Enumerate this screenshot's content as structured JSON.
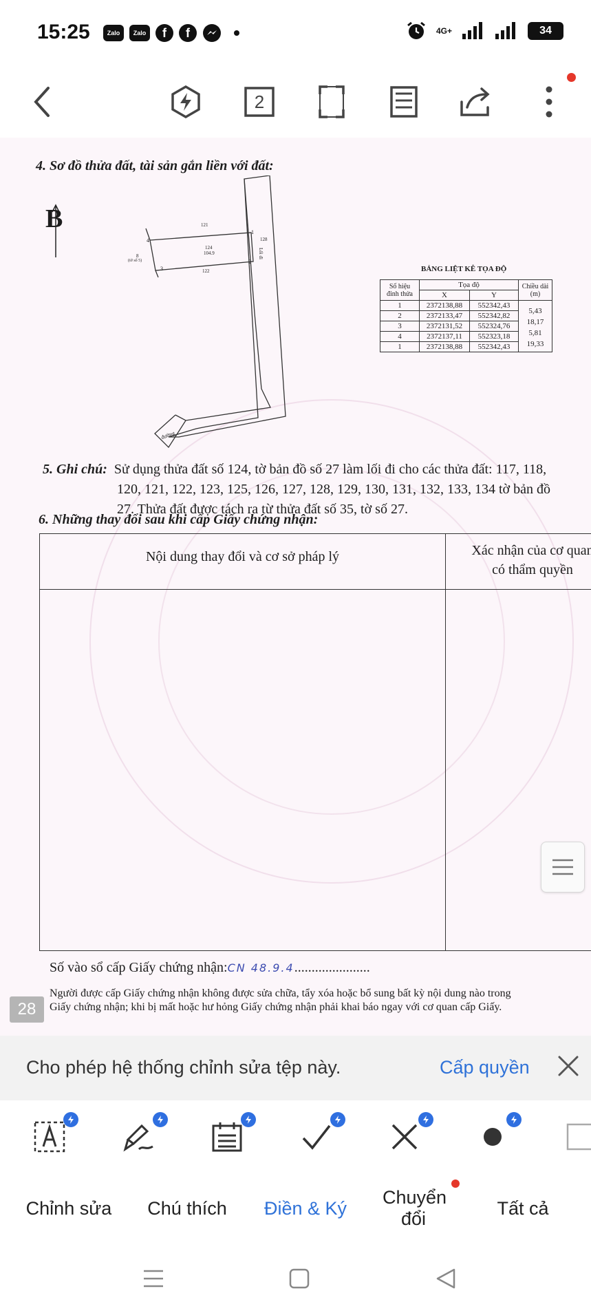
{
  "status_bar": {
    "time": "15:25",
    "app_icons": [
      "Zalo",
      "Zalo",
      "f",
      "f"
    ],
    "network": "4G+",
    "battery": "34"
  },
  "toolbar": {
    "page_count": "2",
    "icons": [
      "back-arrow-icon",
      "lightning-icon",
      "page-count-icon",
      "fullscreen-icon",
      "reader-mode-icon",
      "share-icon",
      "more-vertical-icon"
    ],
    "notification_color": "#e5372a"
  },
  "document": {
    "section4_title": "4. Sơ đồ thửa đất, tài sản gắn liền với đất:",
    "north_label": "B",
    "map_labels": {
      "parcel_top": "121",
      "parcel_main": "124",
      "parcel_area": "104.9",
      "parcel_right": "128",
      "parcel_right_name": "Lối đi",
      "parcel_bottom": "122",
      "parcel_left": "8",
      "parcel_left_sub": "(tờ số 5)",
      "vertex_1": "1",
      "vertex_2": "2",
      "vertex_3": "3",
      "vertex_4": "4",
      "road": "đường"
    },
    "coord_table": {
      "title": "BẢNG LIỆT KÊ TỌA ĐỘ",
      "header_point": "Số hiệu đỉnh thửa",
      "header_coords": "Tọa độ",
      "header_x": "X",
      "header_y": "Y",
      "header_length": "Chiều dài (m)",
      "rows": [
        {
          "point": "1",
          "x": "2372138,88",
          "y": "552342,43"
        },
        {
          "point": "2",
          "x": "2372133,47",
          "y": "552342,82"
        },
        {
          "point": "3",
          "x": "2372131,52",
          "y": "552324,76"
        },
        {
          "point": "4",
          "x": "2372137,11",
          "y": "552323,18"
        },
        {
          "point": "1",
          "x": "2372138,88",
          "y": "552342,43"
        }
      ],
      "lengths": [
        "5,43",
        "18,17",
        "5,81",
        "19,33"
      ]
    },
    "note_label": "5. Ghi chú:",
    "note_line1": "Sử dụng thửa đất số 124, tờ bản đồ số 27 làm lối đi cho các thửa đất: 117, 118,",
    "note_line2": "120, 121, 122, 123, 125, 126, 127, 128, 129, 130, 131, 132, 133, 134 tờ bản đồ",
    "note_line3": "27. Thửa đất được tách ra từ thửa đất số 35, tờ số 27.",
    "section6_title": "6. Những thay đổi sau khi cấp Giấy chứng nhận:",
    "col_content": "Nội dung thay đổi và cơ sở pháp lý",
    "col_confirm_line1": "Xác nhận của cơ quan",
    "col_confirm_line2": "có thẩm quyền",
    "reg_label": "Số vào sổ cấp Giấy chứng nhận:",
    "reg_value": "CN 48.9.4",
    "reg_dots": "......................",
    "warning_line1": "Người được cấp Giấy chứng nhận không được sửa chữa, tẩy xóa hoặc bổ sung bất kỳ nội dung nào trong",
    "warning_line2": "Giấy chứng nhận; khi bị mất hoặc hư hỏng Giấy chứng nhận phải khai báo ngay với cơ quan cấp Giấy.",
    "page_number": "28"
  },
  "permission_bar": {
    "message": "Cho phép hệ thống chỉnh sửa tệp này.",
    "grant_label": "Cấp quyền"
  },
  "tools": [
    "text-box-icon",
    "signature-pen-icon",
    "date-icon",
    "checkmark-icon",
    "cross-icon",
    "dot-icon",
    "rectangle-icon"
  ],
  "tabs": [
    {
      "label": "Chỉnh sửa",
      "active": false
    },
    {
      "label": "Chú thích",
      "active": false
    },
    {
      "label": "Điền & Ký",
      "active": true
    },
    {
      "label": "Chuyển đổi",
      "active": false
    },
    {
      "label": "Tất cả",
      "active": false
    }
  ],
  "colors": {
    "accent": "#2f72d8",
    "badge": "#2f6fe0",
    "notification": "#e5372a"
  }
}
